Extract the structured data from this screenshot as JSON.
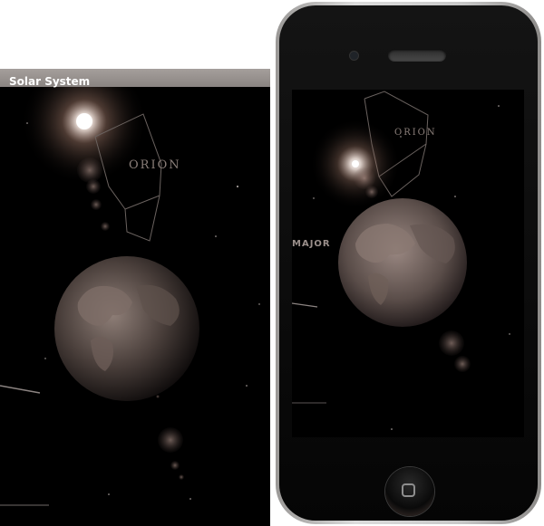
{
  "window": {
    "title": "Solar System"
  },
  "scene": {
    "constellation_label": "ORION",
    "phone_constellation_label": "ORION",
    "phone_partial_label": "MAJOR",
    "colors": {
      "space": "#000000",
      "flare": "#ffffff",
      "halo": "#a87f6e",
      "planet_land": "#8a7b74",
      "planet_ocean": "#2a2424",
      "constellation_line": "#6a625f"
    }
  },
  "icons": {
    "home": "home-button-icon",
    "speaker": "speaker-grille-icon",
    "camera": "front-camera-icon"
  }
}
